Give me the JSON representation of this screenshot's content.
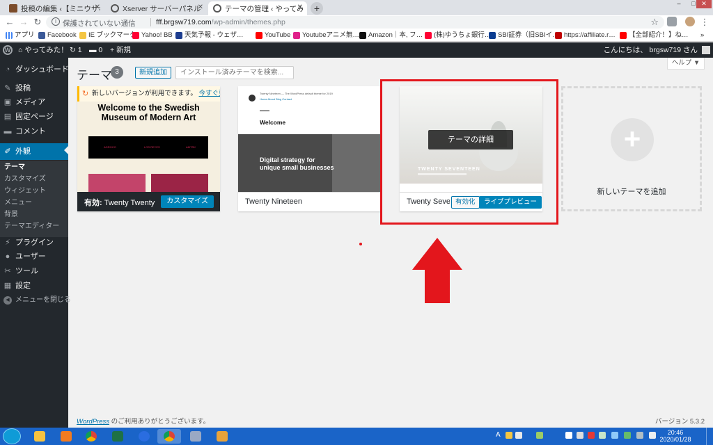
{
  "browser": {
    "tabs": [
      {
        "title": "投稿の編集 ‹【ミニウサギはじ",
        "icon_color": "#7b4b2a"
      },
      {
        "title": "Xserver サーバーパネル",
        "icon_color": "#555555"
      },
      {
        "title": "テーマの管理 ‹ やってみた！ —",
        "icon_color": "#555555"
      }
    ],
    "new_tab_label": "+",
    "window_controls": [
      "–",
      "□",
      "✕"
    ],
    "address": {
      "security_text": "保護されていない通信",
      "host": "fff.brgsw719.com",
      "path": "/wp-admin/themes.php"
    },
    "bookmarks": [
      {
        "label": "アプリ",
        "icon_color": "#4285f4"
      },
      {
        "label": "Facebook",
        "icon_color": "#3b5998"
      },
      {
        "label": "IE ブックマーク",
        "icon_color": "#f4c542"
      },
      {
        "label": "Yahoo! BB",
        "icon_color": "#ff0033"
      },
      {
        "label": "天気予報 - ウェザ…",
        "icon_color": "#1d3d8f"
      },
      {
        "label": "YouTube",
        "icon_color": "#ff0000"
      },
      {
        "label": "Youtubeアニメ無…",
        "icon_color": "#e0218a"
      },
      {
        "label": "Amazon｜本, フ…",
        "icon_color": "#111111"
      },
      {
        "label": "(株)ゆうちょ銀行…",
        "icon_color": "#ff0033"
      },
      {
        "label": "SBI証券（旧SBIイ…",
        "icon_color": "#0b3d91"
      },
      {
        "label": "https://affiliate.r…",
        "icon_color": "#bf0000"
      },
      {
        "label": "【全部紹介！】ね…",
        "icon_color": "#ff0000"
      }
    ]
  },
  "adminbar": {
    "site_name": "やってみた！",
    "updates_count": "1",
    "comments_count": "0",
    "new_label": "新規",
    "greeting": "こんにちは、 brgsw719 さん"
  },
  "sidebar": {
    "items": [
      {
        "label": "ダッシュボード",
        "icon": "dashboard-icon",
        "glyph": "◔"
      },
      {
        "label": "投稿",
        "icon": "pin-icon",
        "glyph": "✎"
      },
      {
        "label": "メディア",
        "icon": "media-icon",
        "glyph": "▣"
      },
      {
        "label": "固定ページ",
        "icon": "page-icon",
        "glyph": "▤"
      },
      {
        "label": "コメント",
        "icon": "comment-icon",
        "glyph": "▬"
      },
      {
        "label": "外観",
        "icon": "brush-icon",
        "glyph": "✐"
      },
      {
        "label": "プラグイン",
        "icon": "plugin-icon",
        "glyph": "⚡"
      },
      {
        "label": "ユーザー",
        "icon": "user-icon",
        "glyph": "●"
      },
      {
        "label": "ツール",
        "icon": "wrench-icon",
        "glyph": "✂"
      },
      {
        "label": "設定",
        "icon": "settings-icon",
        "glyph": "▦"
      },
      {
        "label": "メニューを閉じる",
        "icon": "collapse-icon",
        "glyph": "◀"
      }
    ],
    "submenu": [
      "テーマ",
      "カスタマイズ",
      "ウィジェット",
      "メニュー",
      "背景",
      "テーマエディター"
    ]
  },
  "main": {
    "title": "テーマ",
    "count": "3",
    "add_new": "新規追加",
    "search_placeholder": "インストール済みテーマを検索...",
    "help": "ヘルプ ▼"
  },
  "themes": {
    "active": {
      "notice_text": "新しいバージョンが利用できます。",
      "notice_link": "今すぐ更新",
      "hero_line1": "Welcome to the Swedish",
      "hero_line2": "Museum of Modern Art",
      "band_labels": [
        "AGROCO",
        "LOS REYES",
        "AMTRK"
      ],
      "active_prefix": "有効:",
      "name": "Twenty Twenty",
      "customize": "カスタマイズ"
    },
    "nineteen": {
      "site_line": "Twenty Nineteen — The WordPress default theme for 2019",
      "menu": "Home  About  Blog  Contact",
      "welcome": "Welcome",
      "digital_line1": "Digital strategy for",
      "digital_line2": "unique small businesses",
      "name": "Twenty Nineteen"
    },
    "seventeen": {
      "overlay": "テーマの詳細",
      "title": "TWENTY SEVENTEEN",
      "name": "Twenty Seventeen",
      "activate": "有効化",
      "live_preview": "ライブプレビュー"
    },
    "add_new_label": "新しいテーマを追加"
  },
  "footer": {
    "credit_link": "WordPress",
    "credit_text": " のご利用ありがとうございます。",
    "version": "バージョン 5.3.2"
  },
  "taskbar": {
    "time": "20:46",
    "date": "2020/01/28",
    "tray_letter": "A",
    "apps": [
      {
        "name": "explorer",
        "color": "#f6c342"
      },
      {
        "name": "media",
        "color": "#f27b21"
      },
      {
        "name": "chrome",
        "color": "#db4437"
      },
      {
        "name": "excel",
        "color": "#1e7145"
      },
      {
        "name": "bluetooth",
        "color": "#2a6de0"
      },
      {
        "name": "chrome-active",
        "color": "#4285f4"
      },
      {
        "name": "word",
        "color": "#9aa9c4"
      },
      {
        "name": "paint",
        "color": "#e8a33b"
      }
    ]
  },
  "colors": {
    "accent": "#0073aa",
    "admin_dark": "#23282d",
    "annotation_red": "#e3161c"
  }
}
